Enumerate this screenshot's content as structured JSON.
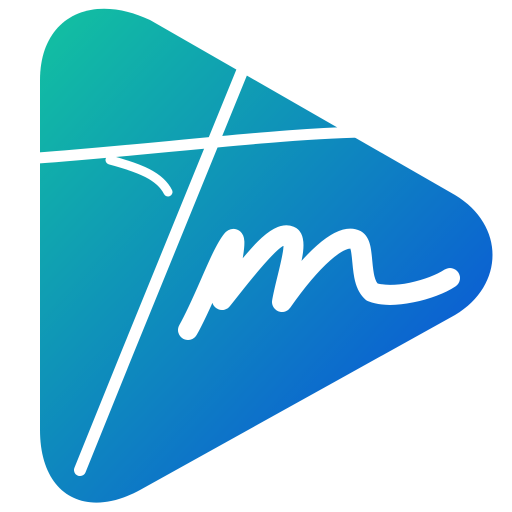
{
  "logo": {
    "monogram": "tm",
    "colors": {
      "gradient_start": "#12c2a0",
      "gradient_end": "#0a47e0",
      "stroke": "#ffffff"
    },
    "icon": "play-button-icon"
  }
}
